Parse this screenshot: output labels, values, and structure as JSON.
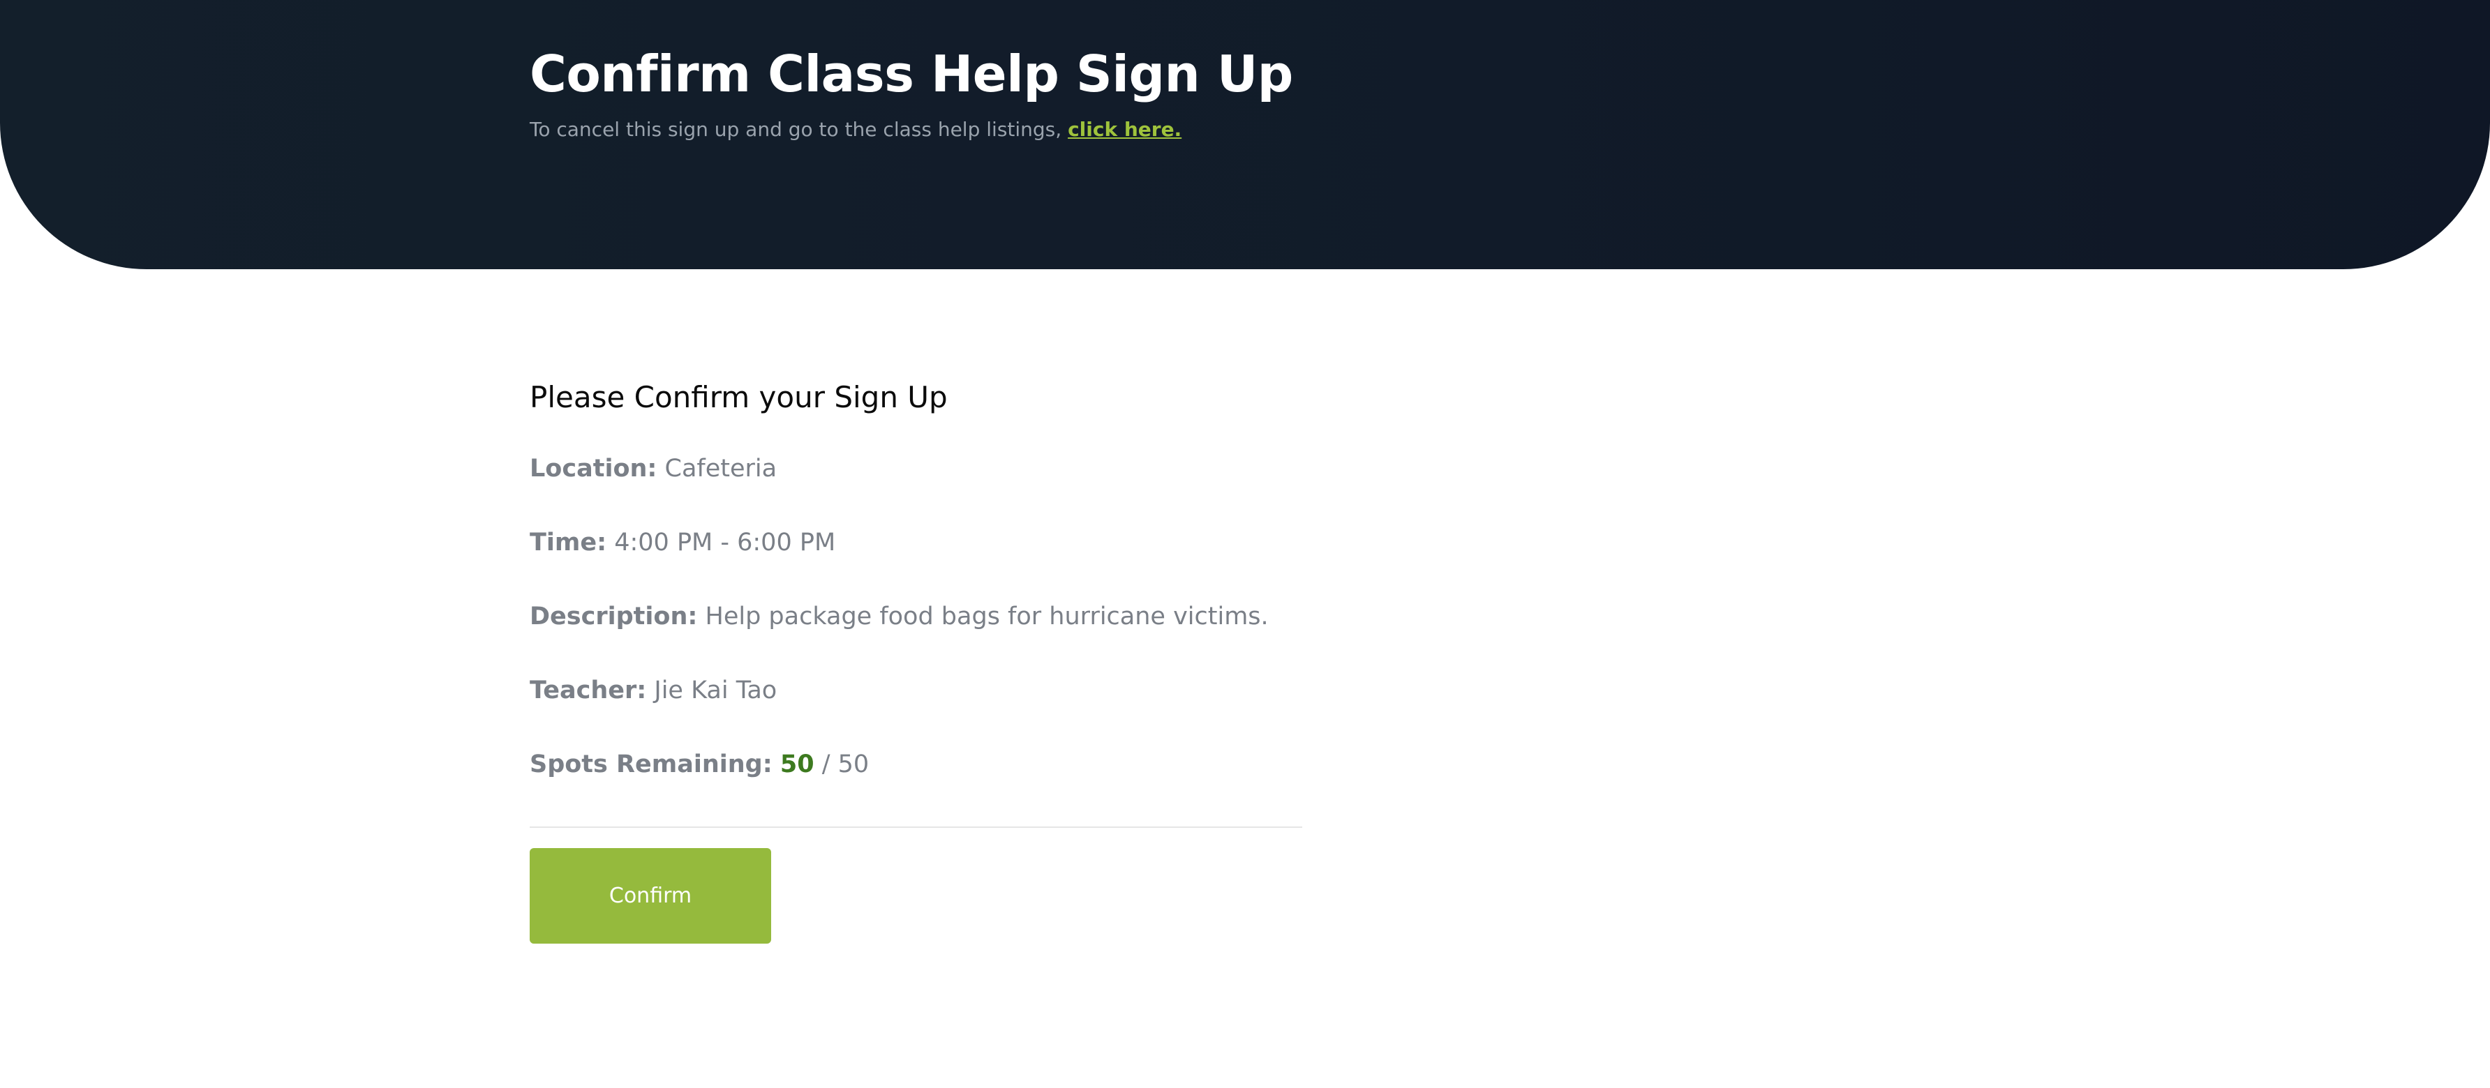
{
  "header": {
    "title": "Confirm Class Help Sign Up",
    "cancel_text": "To cancel this sign up and go to the class help listings, ",
    "cancel_link": "click here."
  },
  "main": {
    "heading": "Please Confirm your Sign Up",
    "location": {
      "label": "Location:",
      "value": "Cafeteria"
    },
    "time": {
      "label": "Time:",
      "value": "4:00 PM - 6:00 PM"
    },
    "description": {
      "label": "Description:",
      "value": "Help package food bags for hurricane victims."
    },
    "teacher": {
      "label": "Teacher:",
      "value": "Jie Kai Tao"
    },
    "spots": {
      "label": "Spots Remaining:",
      "remaining": "50",
      "separator": " / ",
      "total": "50"
    },
    "confirm_label": "Confirm"
  },
  "colors": {
    "hero_background": "#131f2b",
    "accent_green": "#95ba3d",
    "link_green": "#9fc33c",
    "spots_green": "#3d7a1f",
    "muted_text": "#7a7f87"
  }
}
